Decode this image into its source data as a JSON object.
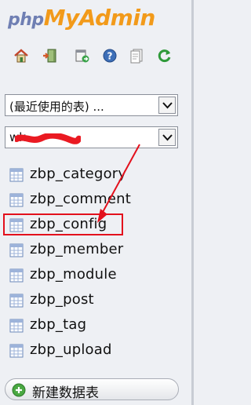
{
  "logo": {
    "part1": "php",
    "part2": "My",
    "part3": "Admin"
  },
  "toolbar": {
    "icons": [
      "home-icon",
      "logout-icon",
      "query-window-icon",
      "help-icon",
      "docs-icon",
      "reload-icon"
    ]
  },
  "recent_tables_select": {
    "value": "(最近使用的表) ..."
  },
  "database_select": {
    "value": "wk"
  },
  "tables": [
    "zbp_category",
    "zbp_comment",
    "zbp_config",
    "zbp_member",
    "zbp_module",
    "zbp_post",
    "zbp_tag",
    "zbp_upload"
  ],
  "highlighted_table": "zbp_config",
  "annotation_color": "#e3101c",
  "new_table_button": {
    "label": "新建数据表"
  }
}
